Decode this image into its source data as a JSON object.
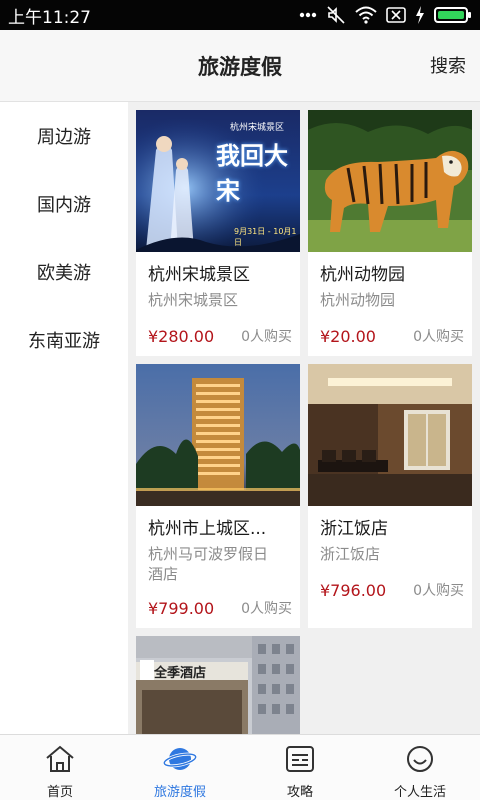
{
  "status_bar": {
    "time": "上午11:27",
    "icons": [
      "more-dots-icon",
      "mute-icon",
      "wifi-icon",
      "sim-x-icon",
      "charging-icon",
      "battery-icon"
    ]
  },
  "header": {
    "title": "旅游度假",
    "search_label": "搜索"
  },
  "sidebar": {
    "items": [
      {
        "label": "周边游"
      },
      {
        "label": "国内游"
      },
      {
        "label": "欧美游"
      },
      {
        "label": "东南亚游"
      }
    ]
  },
  "products": [
    {
      "name": "杭州宋城景区",
      "subtitle": "杭州宋城景区",
      "price": "¥280.00",
      "sold": "0人购买",
      "poster_caption": "杭州宋城景区",
      "poster_title": "我回大宋",
      "poster_date": "9月31日 - 10月1日"
    },
    {
      "name": "杭州动物园",
      "subtitle": "杭州动物园",
      "price": "¥20.00",
      "sold": "0人购买"
    },
    {
      "name": "杭州市上城区...",
      "subtitle": "杭州马可波罗假日酒店",
      "price": "¥799.00",
      "sold": "0人购买"
    },
    {
      "name": "浙江饭店",
      "subtitle": "浙江饭店",
      "price": "¥796.00",
      "sold": "0人购买"
    },
    {
      "sign_text": "全季酒店"
    }
  ],
  "tabbar": {
    "tabs": [
      {
        "label": "首页",
        "icon": "home-icon",
        "active": false
      },
      {
        "label": "旅游度假",
        "icon": "planet-icon",
        "active": true
      },
      {
        "label": "攻略",
        "icon": "guide-card-icon",
        "active": false
      },
      {
        "label": "个人生活",
        "icon": "smile-icon",
        "active": false
      }
    ]
  },
  "colors": {
    "accent": "#2f78e0",
    "price": "#b3151b",
    "status_bar": "#050505",
    "battery": "#32d35a"
  }
}
